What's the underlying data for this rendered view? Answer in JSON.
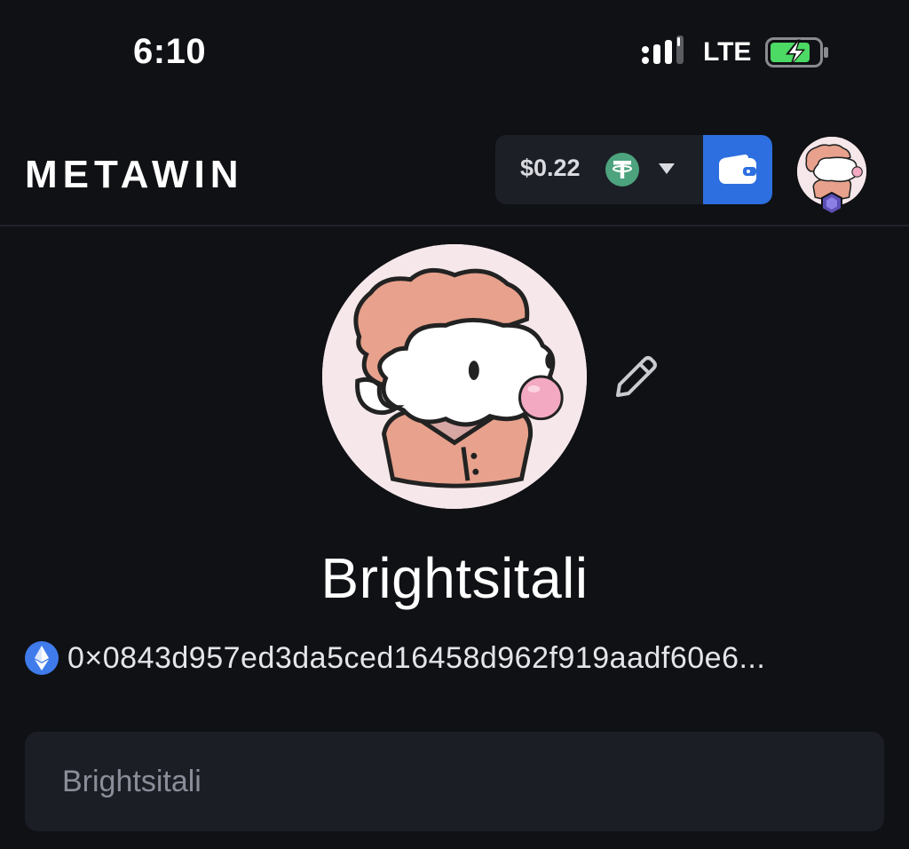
{
  "status_bar": {
    "time": "6:10",
    "network": "LTE",
    "battery_state": "charging"
  },
  "header": {
    "logo_text": "METAWIN",
    "balance": "$0.22",
    "currency_icon": "tether-icon",
    "dropdown_icon": "caret-down-icon",
    "wallet_icon": "wallet-icon",
    "avatar_icon": "user-avatar"
  },
  "profile": {
    "username": "Brightsitali",
    "address_network_icon": "ethereum-icon",
    "wallet_address": "0×0843d957ed3da5ced16458d962f919aadf60e6...",
    "edit_icon": "pencil-icon",
    "username_field_value": "Brightsitali"
  },
  "colors": {
    "background": "#101115",
    "pill": "#1d1f26",
    "wallet_button": "#2d6fe0",
    "tether": "#4ca37d",
    "ethereum": "#3f7bea",
    "battery_green": "#4cd964"
  }
}
